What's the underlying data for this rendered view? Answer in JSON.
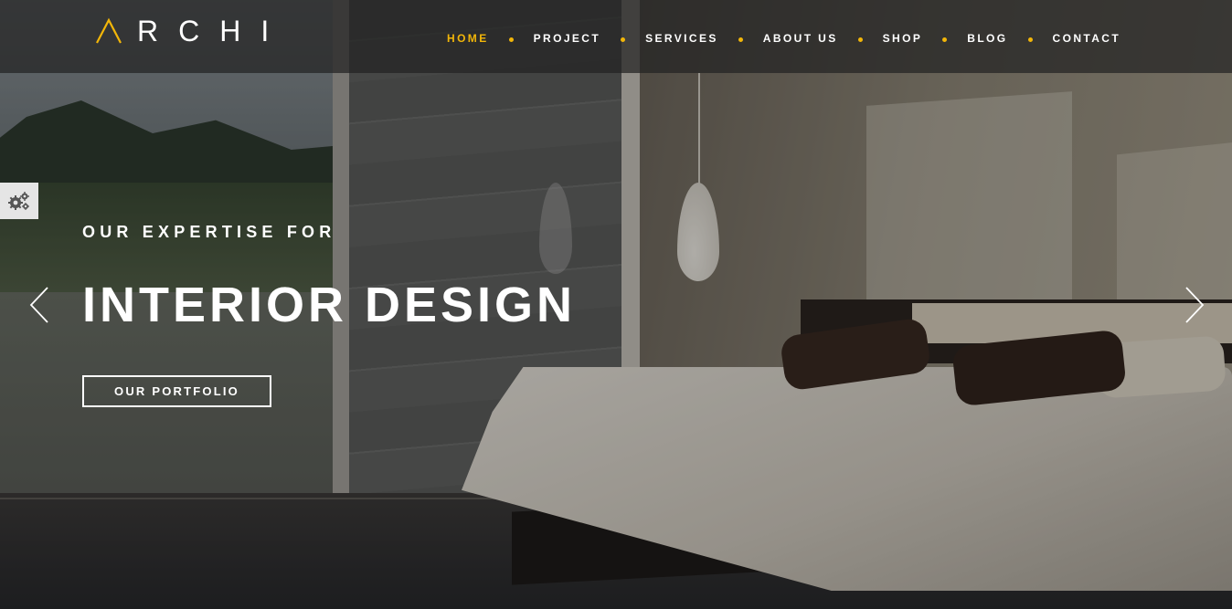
{
  "brand": {
    "logo_text": "RCHI",
    "accent_color": "#f2b609"
  },
  "nav": {
    "items": [
      {
        "label": "HOME",
        "active": true
      },
      {
        "label": "PROJECT",
        "active": false
      },
      {
        "label": "SERVICES",
        "active": false
      },
      {
        "label": "ABOUT US",
        "active": false
      },
      {
        "label": "SHOP",
        "active": false
      },
      {
        "label": "BLOG",
        "active": false
      },
      {
        "label": "CONTACT",
        "active": false
      }
    ]
  },
  "hero": {
    "subtitle": "OUR EXPERTISE FOR",
    "title": "INTERIOR DESIGN",
    "cta_label": "OUR PORTFOLIO"
  },
  "icons": {
    "settings": "gears-icon",
    "prev": "chevron-left-icon",
    "next": "chevron-right-icon",
    "logo_mark": "logo-a-icon"
  }
}
